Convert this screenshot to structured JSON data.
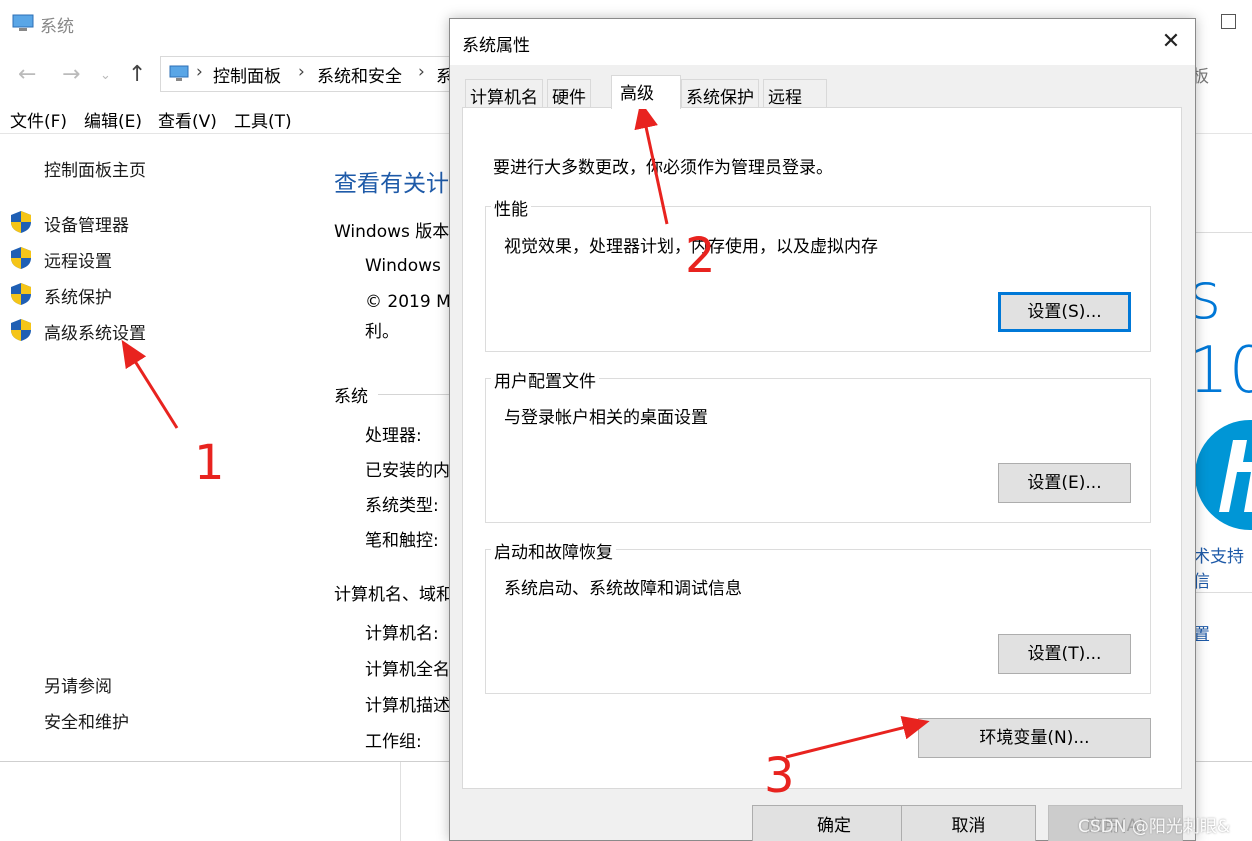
{
  "bg_window": {
    "title": "系统",
    "breadcrumbs": [
      "控制面板",
      "系统和安全",
      "系"
    ],
    "right_partial_title": "板",
    "menus": [
      "文件(F)",
      "编辑(E)",
      "查看(V)",
      "工具(T)"
    ],
    "left_nav": {
      "home": "控制面板主页",
      "items": [
        "设备管理器",
        "远程设置",
        "系统保护",
        "高级系统设置"
      ],
      "see_also_heading": "另请参阅",
      "see_also_link": "安全和维护"
    },
    "main": {
      "title": "查看有关计",
      "windows_edition_heading": "Windows 版本",
      "windows_name": "Windows",
      "copyright": "© 2019 M",
      "copyright_line2": "利。",
      "system_heading": "系统",
      "processor_label": "处理器:",
      "installed_mem_label": "已安装的内",
      "system_type_label": "系统类型:",
      "pen_touch_label": "笔和触控:",
      "computer_section_heading": "计算机名、域和",
      "computer_name_label": "计算机名:",
      "full_name_label": "计算机全名",
      "description_label": "计算机描述",
      "workgroup_label": "工作组:"
    },
    "right_side": {
      "win10_partial": "s 10",
      "support_partial": "术支持信",
      "settings_partial": "置"
    }
  },
  "dialog": {
    "title": "系统属性",
    "close_glyph": "✕",
    "tabs": [
      "计算机名",
      "硬件",
      "高级",
      "系统保护",
      "远程"
    ],
    "active_tab": "高级",
    "admin_notice": "要进行大多数更改，你必须作为管理员登录。",
    "groups": {
      "performance": {
        "label": "性能",
        "desc": "视觉效果，处理器计划，内存使用，以及虚拟内存",
        "button": "设置(S)..."
      },
      "user_profiles": {
        "label": "用户配置文件",
        "desc": "与登录帐户相关的桌面设置",
        "button": "设置(E)..."
      },
      "startup_recovery": {
        "label": "启动和故障恢复",
        "desc": "系统启动、系统故障和调试信息",
        "button": "设置(T)..."
      }
    },
    "env_button": "环境变量(N)...",
    "ok_button": "确定",
    "cancel_button": "取消",
    "apply_button": "应用(A)"
  },
  "annotations": [
    "1",
    "2",
    "3"
  ],
  "watermark": "CSDN @阳光刺眼&",
  "colors": {
    "annotation": "#e8231f",
    "link_blue": "#1e5aa8",
    "focus_blue": "#0078d7",
    "shield_blue": "#1f5fb4",
    "shield_yellow": "#f5c518"
  }
}
